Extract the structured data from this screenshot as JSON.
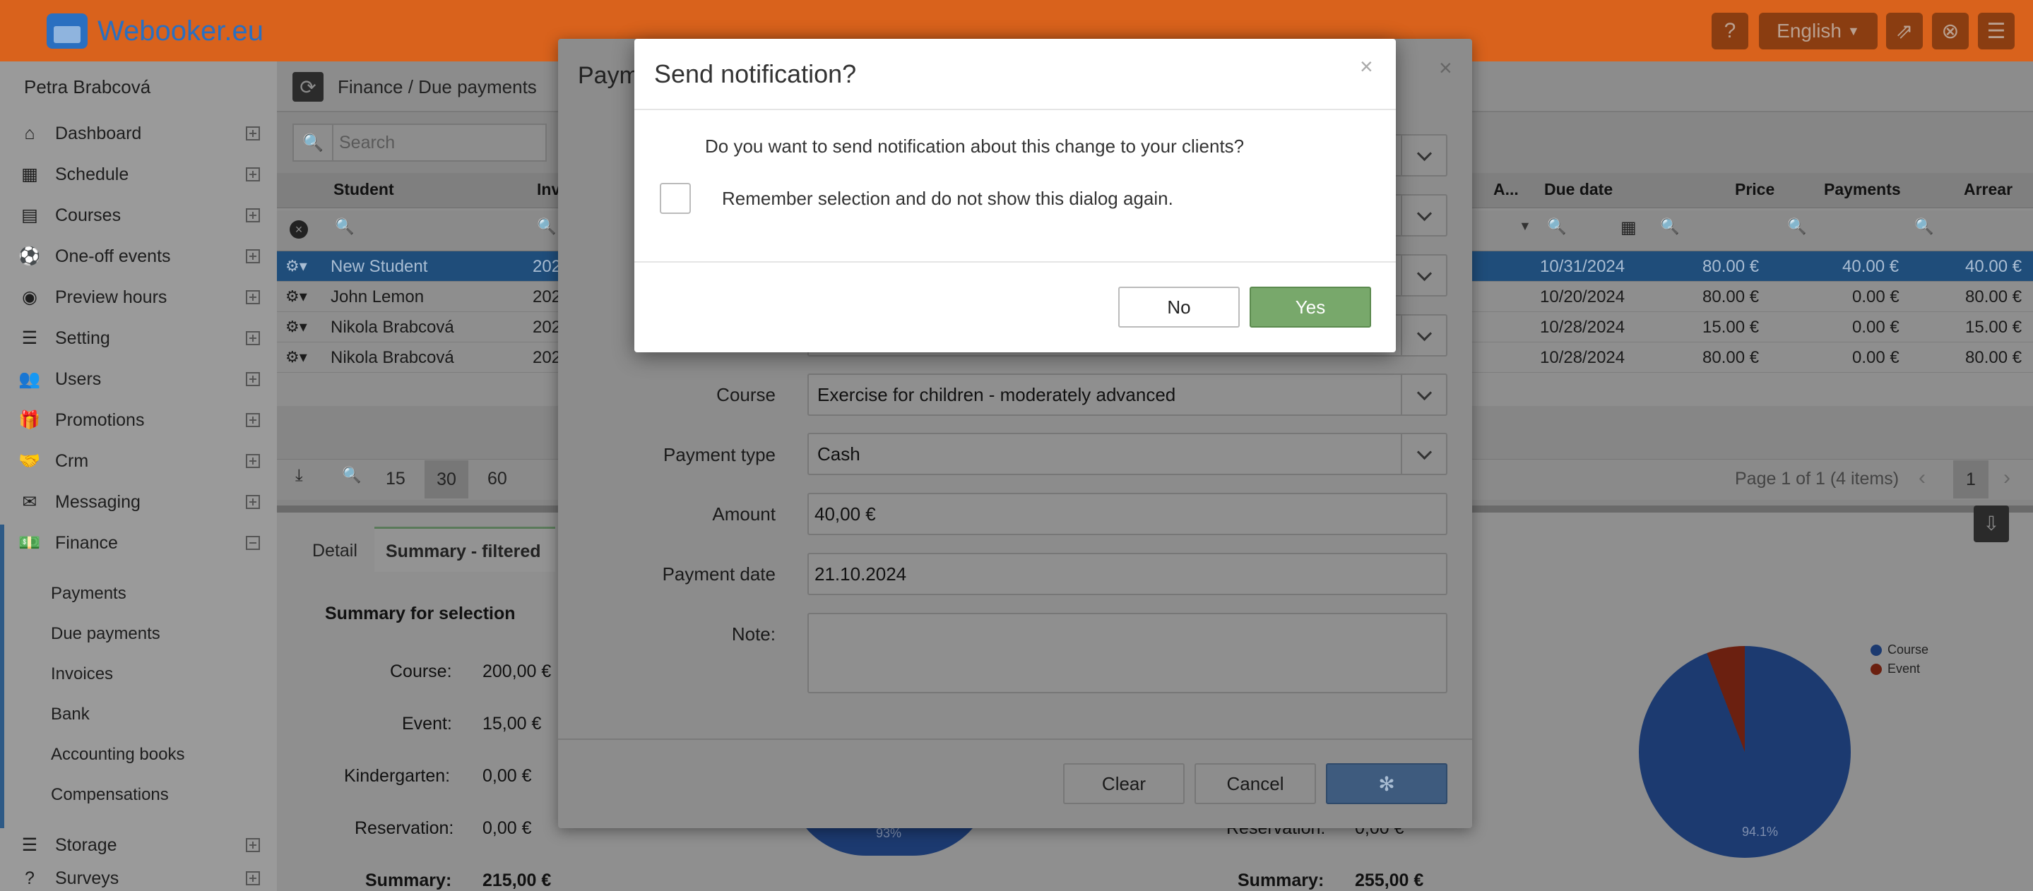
{
  "app": {
    "brand": "Webooker.eu",
    "language": "English",
    "user_name": "Petra Brabcová"
  },
  "sidebar": {
    "items": [
      {
        "label": "Dashboard",
        "icon": "home-icon"
      },
      {
        "label": "Schedule",
        "icon": "calendar-icon"
      },
      {
        "label": "Courses",
        "icon": "courses-icon"
      },
      {
        "label": "One-off events",
        "icon": "soccer-ball-icon"
      },
      {
        "label": "Preview hours",
        "icon": "eye-icon"
      },
      {
        "label": "Setting",
        "icon": "sliders-icon"
      },
      {
        "label": "Users",
        "icon": "users-icon"
      },
      {
        "label": "Promotions",
        "icon": "gift-icon"
      },
      {
        "label": "Crm",
        "icon": "handshake-icon"
      },
      {
        "label": "Messaging",
        "icon": "envelope-icon"
      },
      {
        "label": "Finance",
        "icon": "money-icon"
      }
    ],
    "finance_sub": [
      "Payments",
      "Due payments",
      "Invoices",
      "Bank",
      "Accounting books",
      "Compensations"
    ],
    "after_items": [
      {
        "label": "Storage",
        "icon": "database-icon"
      },
      {
        "label": "Surveys",
        "icon": "question-icon"
      }
    ]
  },
  "breadcrumb": "Finance / Due payments",
  "search_placeholder": "Search",
  "grid": {
    "headers": {
      "student": "Student",
      "inv": "Inv",
      "a": "A...",
      "due_date": "Due date",
      "price": "Price",
      "payments": "Payments",
      "arrear": "Arrear"
    },
    "rows": [
      {
        "student": "New Student",
        "inv": "202",
        "due": "10/31/2024",
        "price": "80.00 €",
        "payments": "40.00 €",
        "arrear": "40.00 €",
        "selected": true
      },
      {
        "student": "John Lemon",
        "inv": "202",
        "due": "10/20/2024",
        "price": "80.00 €",
        "payments": "0.00 €",
        "arrear": "80.00 €",
        "selected": false
      },
      {
        "student": "Nikola Brabcová",
        "inv": "202",
        "due": "10/28/2024",
        "price": "15.00 €",
        "payments": "0.00 €",
        "arrear": "15.00 €",
        "selected": false
      },
      {
        "student": "Nikola Brabcová",
        "inv": "202",
        "due": "10/28/2024",
        "price": "80.00 €",
        "payments": "0.00 €",
        "arrear": "80.00 €",
        "selected": false
      }
    ],
    "page_sizes": [
      "15",
      "30",
      "60"
    ],
    "page_info": "Page 1 of 1 (4 items)",
    "current_page": "1"
  },
  "bottom": {
    "tab_detail": "Detail",
    "tab_summary": "Summary - filtered",
    "summary_title": "Summary for selection",
    "summary": [
      {
        "label": "Course:",
        "value": "200,00 €"
      },
      {
        "label": "Event:",
        "value": "15,00 €"
      },
      {
        "label": "Kindergarten:",
        "value": "0,00 €"
      },
      {
        "label": "Reservation:",
        "value": "0,00 €"
      },
      {
        "label": "Summary:",
        "value": "215,00 €"
      }
    ],
    "right_reservation_label": "Reservation:",
    "right_reservation_value": "0,00 €",
    "right_summary_label": "Summary:",
    "right_summary_value": "255,00 €",
    "left_pie_pct": "93%",
    "right_pie_pct": "94.1%",
    "legend": [
      {
        "label": "Course",
        "color": "#1c3a70"
      },
      {
        "label": "Event",
        "color": "#6b2010"
      }
    ]
  },
  "payment_modal": {
    "title": "Paym",
    "course_label": "Course",
    "course_value": "Exercise for children - moderately advanced",
    "payment_type_label": "Payment type",
    "payment_type_value": "Cash",
    "amount_label": "Amount",
    "amount_value": "40,00 €",
    "payment_date_label": "Payment date",
    "payment_date_value": "21.10.2024",
    "note_label": "Note:",
    "clear": "Clear",
    "cancel": "Cancel"
  },
  "dialog": {
    "title": "Send notification?",
    "question": "Do you want to send notification about this change to your clients?",
    "remember": "Remember selection and do not show this dialog again.",
    "no": "No",
    "yes": "Yes",
    "close": "×"
  }
}
